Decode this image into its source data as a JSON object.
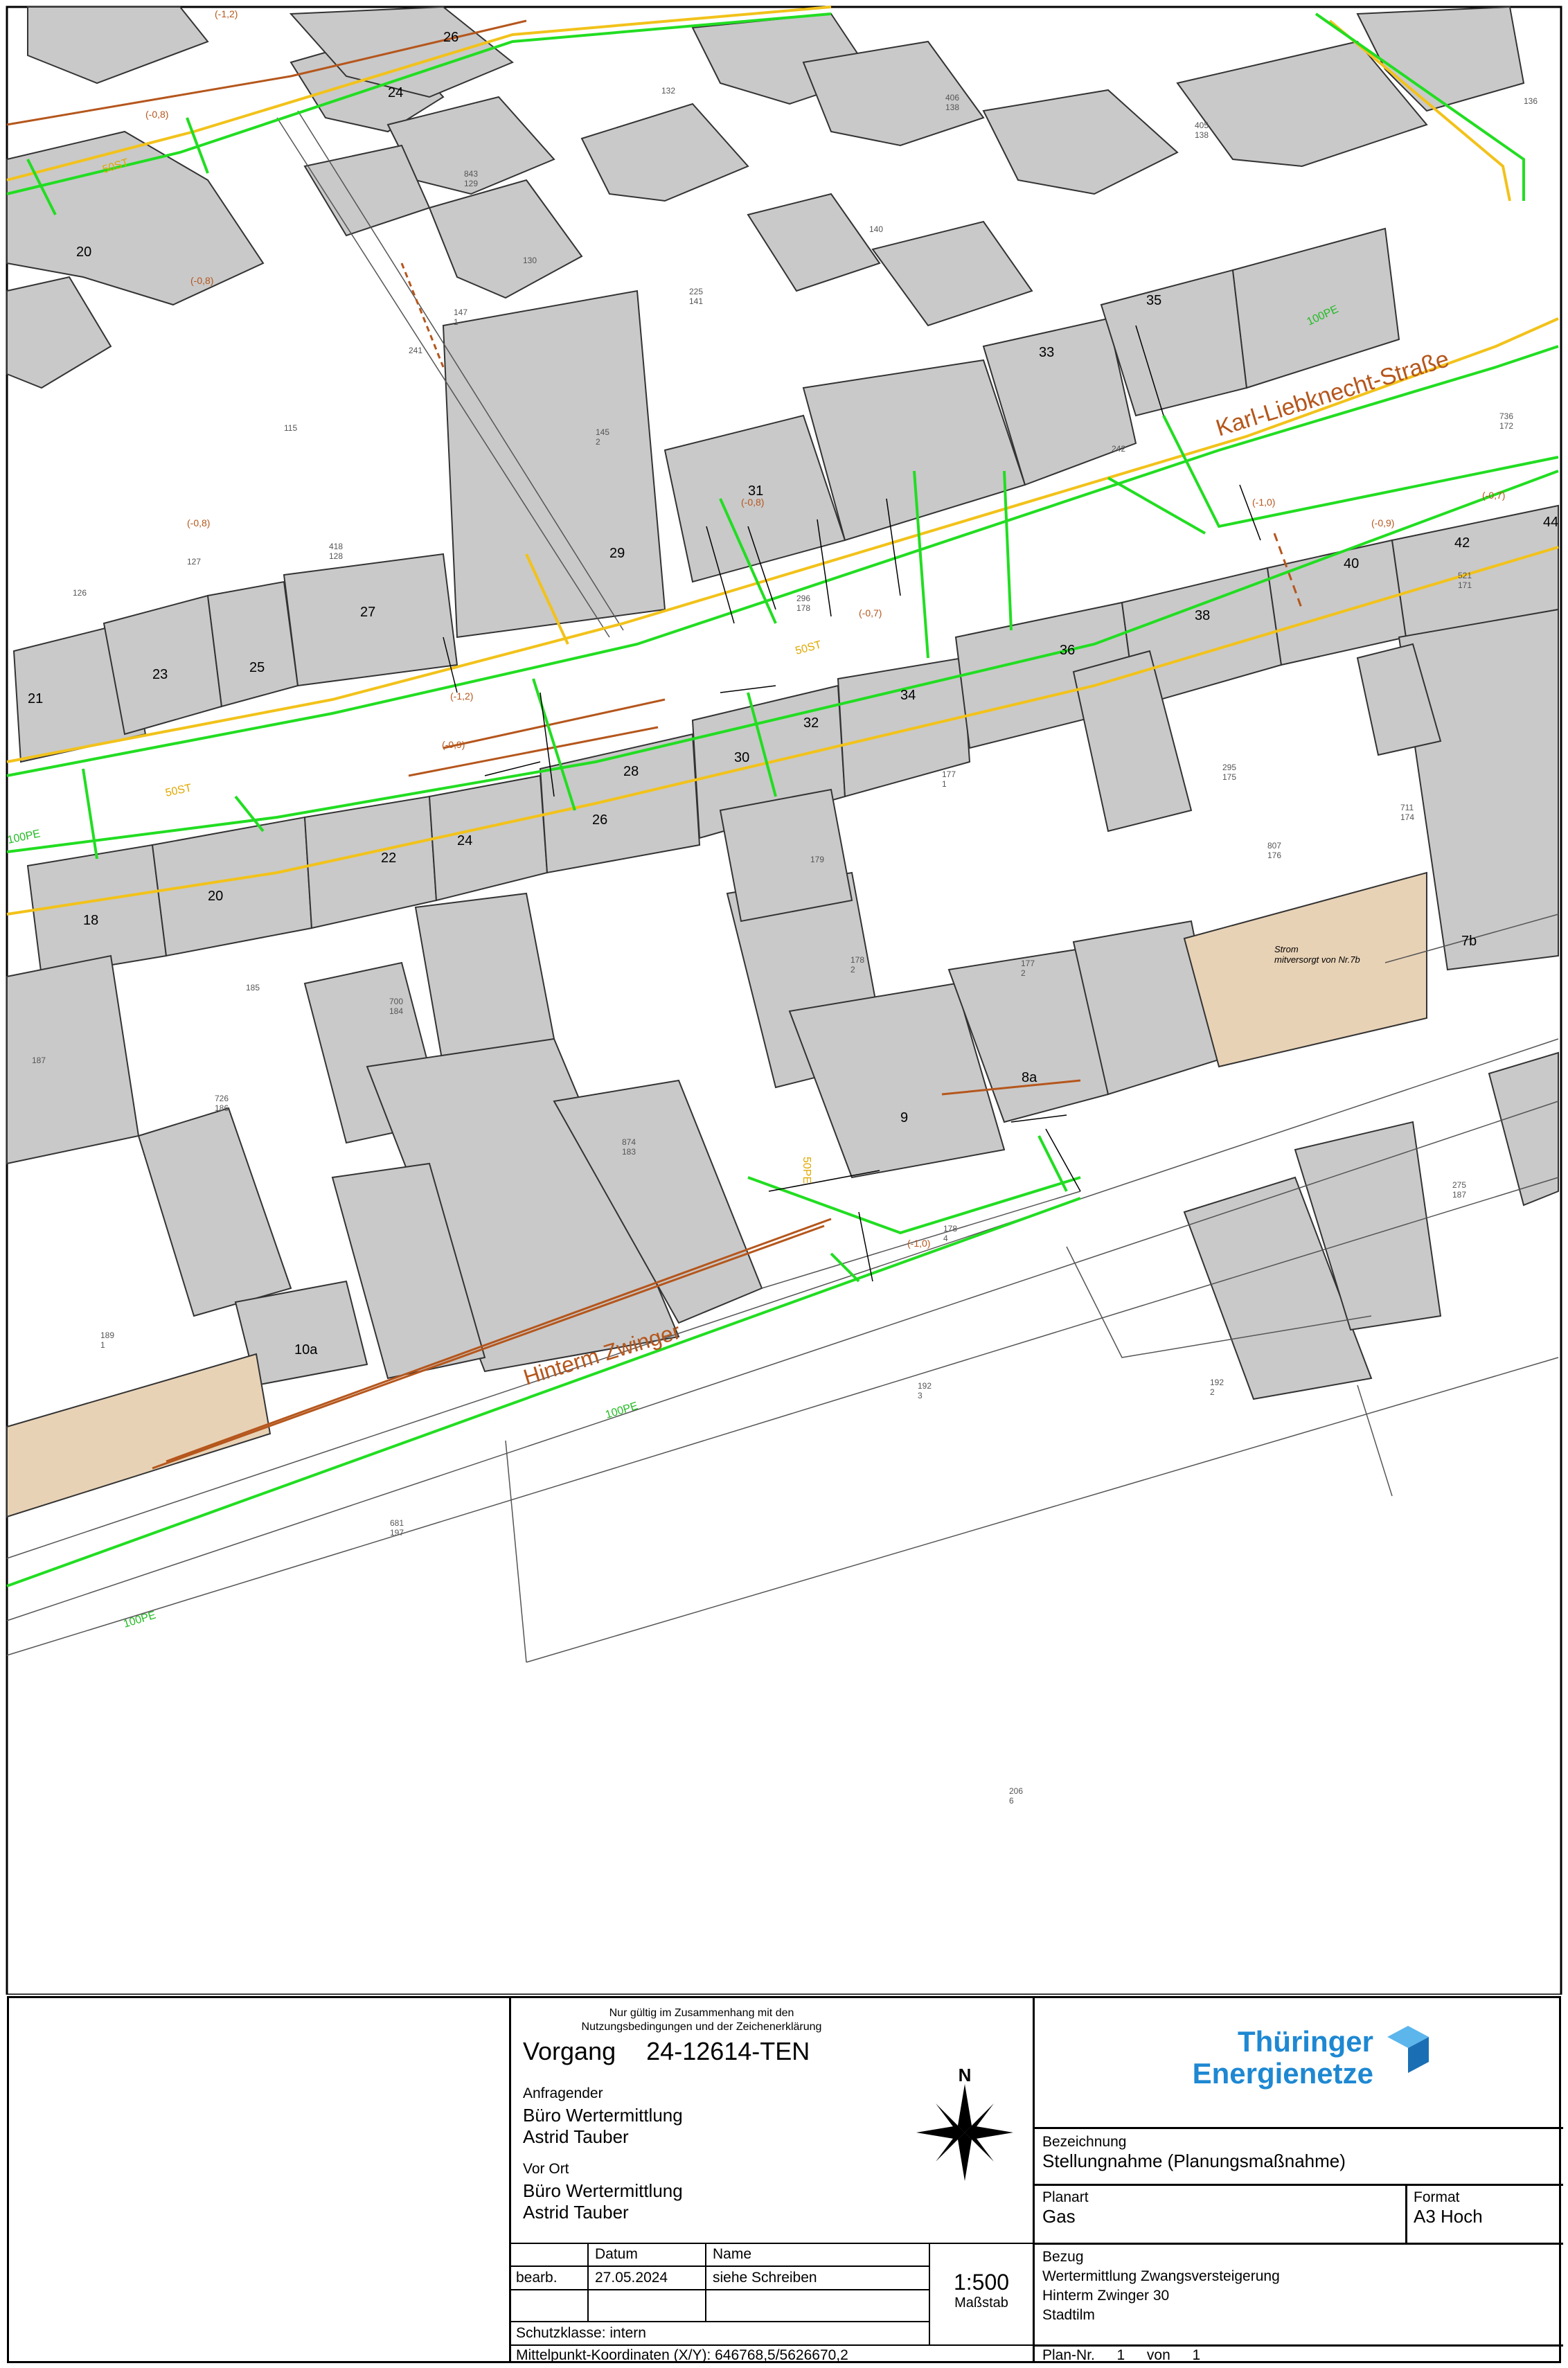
{
  "map": {
    "streets": {
      "karl": "Karl-Liebknecht-Straße",
      "zwinger": "Hinterm Zwinger"
    },
    "pipe_labels": [
      "100PE",
      "100PE",
      "100PE",
      "100PE",
      "50ST",
      "50ST",
      "50ST",
      "50PE"
    ],
    "house_numbers": [
      "20",
      "21",
      "23",
      "25",
      "27",
      "29",
      "31",
      "33",
      "35",
      "36",
      "38",
      "40",
      "42",
      "44",
      "32",
      "34",
      "30",
      "28",
      "26",
      "24",
      "22",
      "20",
      "18",
      "26",
      "24",
      "9",
      "8a",
      "10a",
      "7b"
    ],
    "parcels": [
      "132",
      "140",
      "136",
      "406\n138",
      "405\n138",
      "843\n129",
      "130",
      "147\n1",
      "225\n141",
      "241",
      "115",
      "145\n2",
      "418\n128",
      "127",
      "126",
      "736\n172",
      "242",
      "296\n178",
      "521\n171",
      "295\n175",
      "177\n1",
      "711\n174",
      "807\n176",
      "179",
      "178\n2",
      "177\n2",
      "185",
      "700\n184",
      "187",
      "726\n186",
      "874\n183",
      "178\n4",
      "275\n187",
      "189\n1",
      "192\n3",
      "192\n2",
      "681\n197",
      "206\n6"
    ],
    "depths": [
      "(-0,8)",
      "(-0,8)",
      "(-0,8)",
      "(-1,2)",
      "(-0,9)",
      "(-1,2)",
      "(-0,7)",
      "(-0,8)",
      "(-1,0)",
      "(-0,9)",
      "(-0,7)",
      "(-1,0)"
    ],
    "annotation": "Strom\nmitversorgt von Nr.7b"
  },
  "title_block": {
    "notice_line1": "Nur gültig im Zusammenhang mit den",
    "notice_line2": "Nutzungsbedingungen und der Zeichenerklärung",
    "vorgang_label": "Vorgang",
    "vorgang_value": "24-12614-TEN",
    "anfragender_label": "Anfragender",
    "anfragender_line1": "Büro Wertermittlung",
    "anfragender_line2": "Astrid Tauber",
    "vorort_label": "Vor Ort",
    "vorort_line1": "Büro Wertermittlung",
    "vorort_line2": "Astrid Tauber",
    "north": "N",
    "datum_label": "Datum",
    "name_label": "Name",
    "bearb_label": "bearb.",
    "datum_value": "27.05.2024",
    "name_value": "siehe Schreiben",
    "scale": "1:500",
    "scale_label": "Maßstab",
    "schutzklasse": "Schutzklasse: intern",
    "koordinaten": "Mittelpunkt-Koordinaten (X/Y): 646768,5/5626670,2",
    "logo_line1": "Thüringer",
    "logo_line2": "Energienetze",
    "bezeichnung_label": "Bezeichnung",
    "bezeichnung_value": "Stellungnahme (Planungsmaßnahme)",
    "planart_label": "Planart",
    "planart_value": "Gas",
    "format_label": "Format",
    "format_value": "A3 Hoch",
    "bezug_label": "Bezug",
    "bezug_line1": "Wertermittlung Zwangsversteigerung",
    "bezug_line2": "Hinterm Zwinger 30",
    "bezug_line3": "Stadtilm",
    "plannr_label": "Plan-Nr.",
    "plannr_value": "1",
    "von_label": "von",
    "von_value": "1",
    "colors": {
      "brand": "#1e88d2",
      "gas_pipe": "#22dd22",
      "water_line": "#f2c21a",
      "electric": "#b5561c",
      "building": "#c8c8c8",
      "highlight": "#e8d2b6"
    }
  }
}
